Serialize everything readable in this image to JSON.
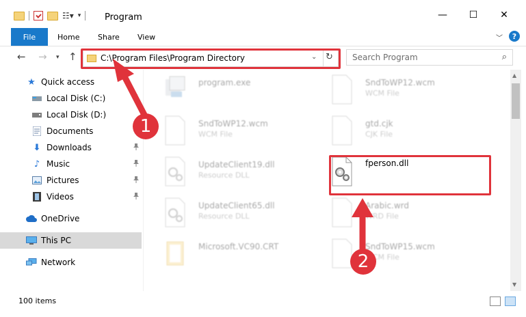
{
  "window": {
    "title": "Program",
    "minimize": "—",
    "maximize": "☐",
    "close": "✕"
  },
  "ribbon": {
    "tabs": [
      "File",
      "Home",
      "Share",
      "View"
    ]
  },
  "address": {
    "path": "C:\\Program Files\\Program Directory",
    "search_placeholder": "Search Program"
  },
  "sidebar": {
    "items": [
      {
        "label": "Quick access",
        "icon": "star-icon",
        "pinned": false
      },
      {
        "label": "Local Disk (C:)",
        "icon": "drive-icon",
        "pinned": true
      },
      {
        "label": "Local Disk (D:)",
        "icon": "drive-icon",
        "pinned": false
      },
      {
        "label": "Documents",
        "icon": "documents-icon",
        "pinned": true
      },
      {
        "label": "Downloads",
        "icon": "download-icon",
        "pinned": true
      },
      {
        "label": "Music",
        "icon": "music-icon",
        "pinned": true
      },
      {
        "label": "Pictures",
        "icon": "pictures-icon",
        "pinned": true
      },
      {
        "label": "Videos",
        "icon": "videos-icon",
        "pinned": true
      },
      {
        "label": "OneDrive",
        "icon": "cloud-icon",
        "pinned": false
      },
      {
        "label": "This PC",
        "icon": "computer-icon",
        "pinned": false,
        "selected": true
      },
      {
        "label": "Network",
        "icon": "network-icon",
        "pinned": false
      }
    ]
  },
  "files": [
    {
      "name": "program.exe",
      "type": "",
      "icon": "exe-icon"
    },
    {
      "name": "SndToWP12.wcm",
      "type": "WCM File",
      "icon": "file-icon"
    },
    {
      "name": "SndToWP12.wcm",
      "type": "WCM File",
      "icon": "file-icon"
    },
    {
      "name": "gtd.cjk",
      "type": "CJK File",
      "icon": "file-icon"
    },
    {
      "name": "UpdateClient19.dll",
      "type": "Resource DLL",
      "icon": "dll-icon"
    },
    {
      "name": "fperson.dll",
      "type": "",
      "icon": "dll-icon"
    },
    {
      "name": "UpdateClient65.dll",
      "type": "Resource DLL",
      "icon": "dll-icon"
    },
    {
      "name": "Arabic.wrd",
      "type": "WRD File",
      "icon": "file-icon"
    },
    {
      "name": "Microsoft.VC90.CRT",
      "type": "",
      "icon": "folder-icon"
    },
    {
      "name": "SndToWP15.wcm",
      "type": "WCM File",
      "icon": "file-icon"
    }
  ],
  "status": {
    "item_count": "100 items"
  },
  "callouts": [
    "1",
    "2"
  ],
  "colors": {
    "accent": "#1979ca",
    "highlight": "#e0333b"
  }
}
